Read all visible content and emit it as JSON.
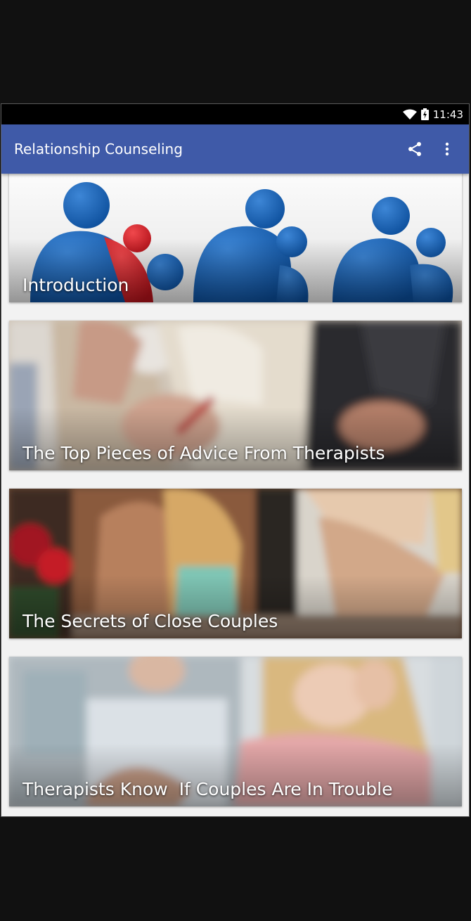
{
  "status_bar": {
    "time": "11:43",
    "icons": [
      "wifi-icon",
      "battery-icon"
    ]
  },
  "app_bar": {
    "title": "Relationship Counseling",
    "actions": [
      {
        "name": "share-icon"
      },
      {
        "name": "more-vert-icon"
      }
    ]
  },
  "articles": [
    {
      "title": "Introduction",
      "image": "people-icons-illustration"
    },
    {
      "title": "The Top Pieces of Advice From Therapists",
      "image": "therapy-session-photo"
    },
    {
      "title": "The Secrets of Close Couples",
      "image": "couple-bathroom-photo"
    },
    {
      "title": "Therapists Know  If Couples Are In Trouble",
      "image": "worried-woman-photo"
    }
  ],
  "colors": {
    "app_bar": "#3f5aa8",
    "status_bar": "#000000",
    "background": "#f2f2f2"
  }
}
